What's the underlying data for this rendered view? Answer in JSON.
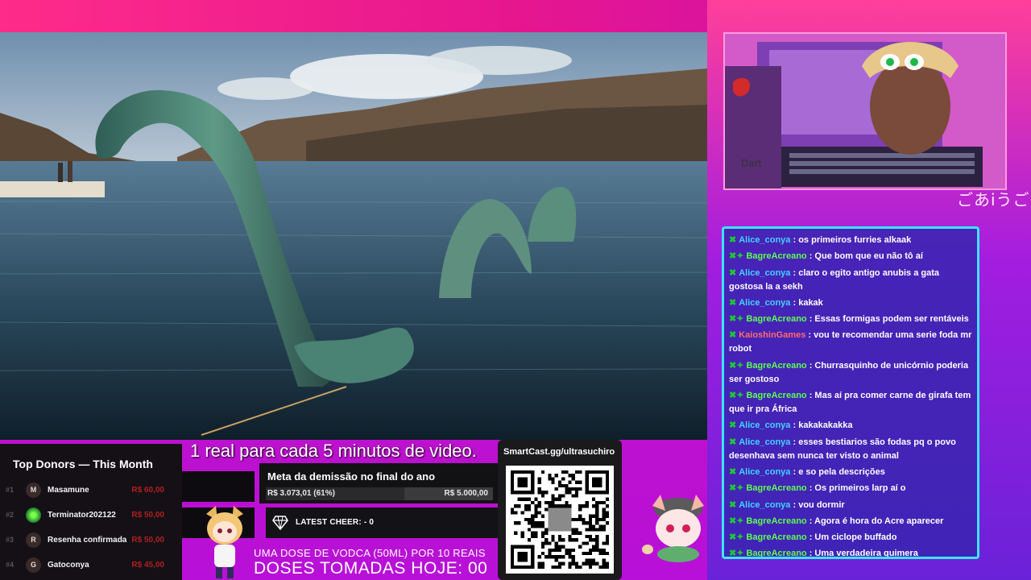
{
  "chat": {
    "messages": [
      {
        "user": "Alice_conya",
        "text": ": os primeiros furries alkaak",
        "color": "alice",
        "badges": "✖"
      },
      {
        "user": "BagreAcreano",
        "text": ": Que bom que eu não tô aí",
        "color": "bagre",
        "badges": "✖✦"
      },
      {
        "user": "Alice_conya",
        "text": ": claro o egito antigo anubis a gata gostosa la a sekh",
        "color": "alice",
        "badges": "✖"
      },
      {
        "user": "Alice_conya",
        "text": ": kakak",
        "color": "alice",
        "badges": "✖"
      },
      {
        "user": "BagreAcreano",
        "text": ": Essas formigas podem ser rentáveis",
        "color": "bagre",
        "badges": "✖✦"
      },
      {
        "user": "KaioshinGames",
        "text": ": vou te recomendar uma serie foda mr robot",
        "color": "kaio",
        "badges": "✖"
      },
      {
        "user": "BagreAcreano",
        "text": ": Churrasquinho de unicórnio poderia ser gostoso",
        "color": "bagre",
        "badges": "✖✦"
      },
      {
        "user": "BagreAcreano",
        "text": ": Mas aí pra comer carne de girafa tem que ir pra África",
        "color": "bagre",
        "badges": "✖✦"
      },
      {
        "user": "Alice_conya",
        "text": ": kakakakakka",
        "color": "alice",
        "badges": "✖"
      },
      {
        "user": "Alice_conya",
        "text": ": esses bestiarios são fodas pq o povo desenhava sem nunca ter visto o animal",
        "color": "alice",
        "badges": "✖"
      },
      {
        "user": "Alice_conya",
        "text": ": e so pela descrições",
        "color": "alice",
        "badges": "✖"
      },
      {
        "user": "BagreAcreano",
        "text": ": Os primeiros larp aí o",
        "color": "bagre",
        "badges": "✖✦"
      },
      {
        "user": "Alice_conya",
        "text": ": vou dormir",
        "color": "alice",
        "badges": "✖"
      },
      {
        "user": "BagreAcreano",
        "text": ": Agora é hora do Acre aparecer",
        "color": "bagre",
        "badges": "✖✦"
      },
      {
        "user": "BagreAcreano",
        "text": ": Um ciclope buffado",
        "color": "bagre",
        "badges": "✖✦"
      },
      {
        "user": "BagreAcreano",
        "text": ": Uma verdadeira quimera",
        "color": "bagre",
        "badges": "✖✦"
      }
    ]
  },
  "subtitle": "1 real para cada 5 minutos de video.",
  "donors": {
    "title": "Top Donors — This Month",
    "rows": [
      {
        "rank": "#1",
        "initial": "M",
        "name": "Masamune",
        "amount": "R$ 60,00"
      },
      {
        "rank": "#2",
        "initial": "",
        "name": "Terminator202122",
        "amount": "R$ 50,00"
      },
      {
        "rank": "#3",
        "initial": "R",
        "name": "Resenha confirmada",
        "amount": "R$ 50,00"
      },
      {
        "rank": "#4",
        "initial": "G",
        "name": "Gatoconya",
        "amount": "R$ 45,00"
      }
    ]
  },
  "meta": {
    "title": "Meta da demissão no final do ano",
    "current": "R$ 3.073,01 (61%)",
    "goal": "R$ 5.000,00",
    "progress": 0.61
  },
  "cheer": {
    "text": "LATEST CHEER: - 0"
  },
  "vodka": {
    "line1": "UMA DOSE DE VODCA (50ML) POR 10 REAIS",
    "line2": "DOSES TOMADAS HOJE: 00"
  },
  "qr": {
    "label": "SmartCast.gg/ultrasuchiro"
  },
  "facecam": {
    "tag": "ごあiうご",
    "keyboard_label": "Dart"
  }
}
